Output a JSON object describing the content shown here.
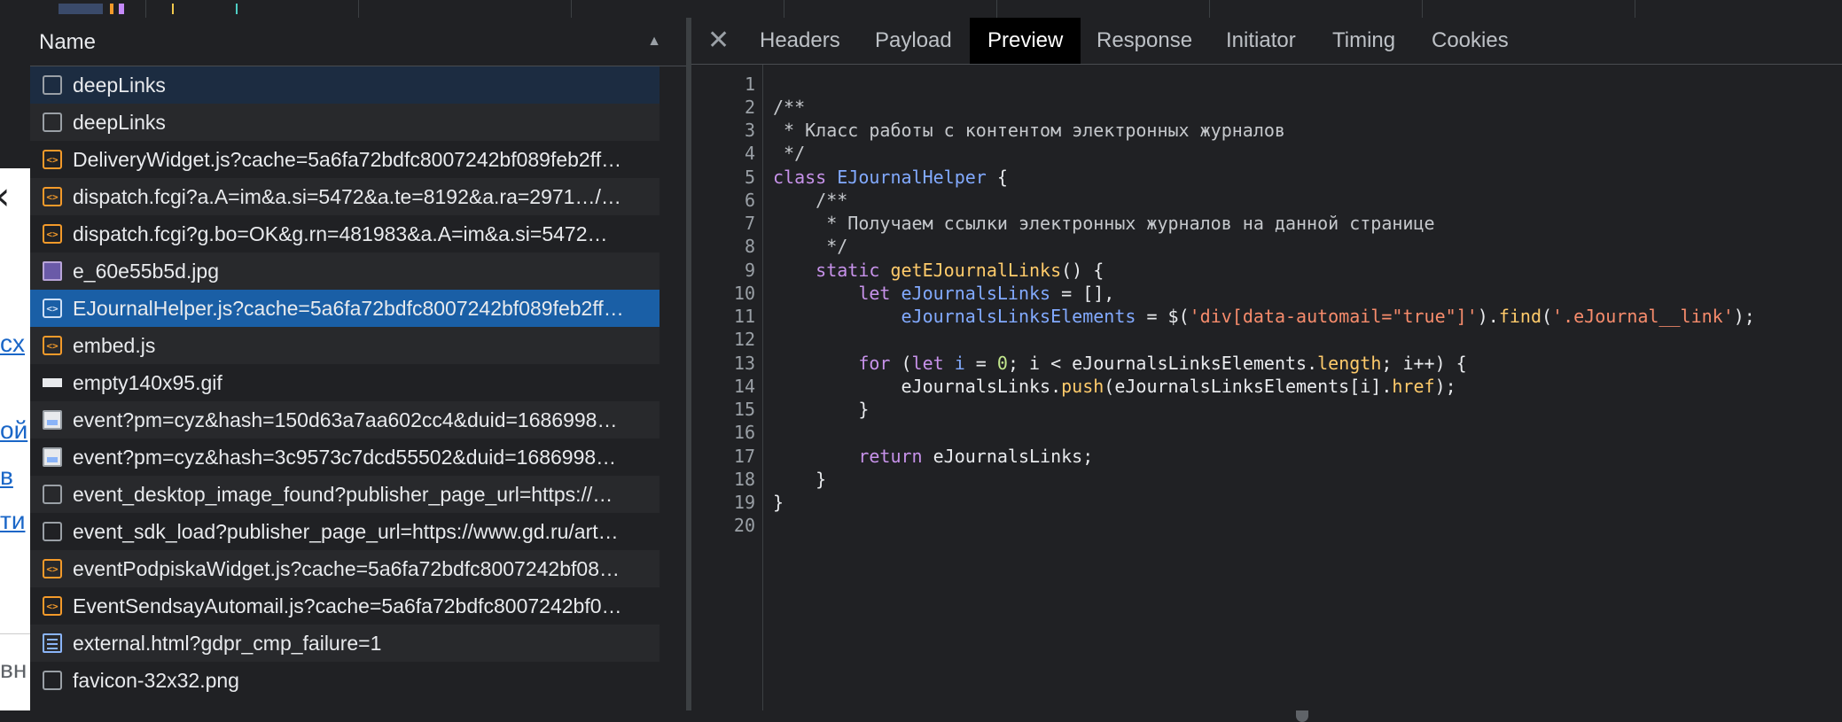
{
  "background_page": {
    "fragments": [
      "сх",
      "ой",
      "в",
      "ти",
      "вн"
    ]
  },
  "network_list": {
    "column_header": "Name",
    "sort_indicator": "▲",
    "rows": [
      {
        "icon": "checkbox-icon",
        "name": "deepLinks"
      },
      {
        "icon": "checkbox-icon",
        "name": "deepLinks"
      },
      {
        "icon": "script-icon",
        "name": "DeliveryWidget.js?cache=5a6fa72bdfc8007242bf089feb2ff…"
      },
      {
        "icon": "script-icon",
        "name": "dispatch.fcgi?a.A=im&a.si=5472&a.te=8192&a.ra=2971…/…"
      },
      {
        "icon": "script-icon",
        "name": "dispatch.fcgi?g.bo=OK&g.rn=481983&a.A=im&a.si=5472…"
      },
      {
        "icon": "image-icon",
        "name": "e_60e55b5d.jpg"
      },
      {
        "icon": "script-icon",
        "name": "EJournalHelper.js?cache=5a6fa72bdfc8007242bf089feb2ff…"
      },
      {
        "icon": "script-icon",
        "name": "embed.js"
      },
      {
        "icon": "gif-icon",
        "name": "empty140x95.gif"
      },
      {
        "icon": "event-icon",
        "name": "event?pm=cyz&hash=150d63a7aa602cc4&duid=1686998…"
      },
      {
        "icon": "event-icon",
        "name": "event?pm=cyz&hash=3c9573c7dcd55502&duid=1686998…"
      },
      {
        "icon": "checkbox-icon",
        "name": "event_desktop_image_found?publisher_page_url=https://…"
      },
      {
        "icon": "checkbox-icon",
        "name": "event_sdk_load?publisher_page_url=https://www.gd.ru/art…"
      },
      {
        "icon": "script-icon",
        "name": "eventPodpiskaWidget.js?cache=5a6fa72bdfc8007242bf08…"
      },
      {
        "icon": "script-icon",
        "name": "EventSendsayAutomail.js?cache=5a6fa72bdfc8007242bf0…"
      },
      {
        "icon": "html-doc-icon",
        "name": "external.html?gdpr_cmp_failure=1"
      },
      {
        "icon": "checkbox-icon",
        "name": "favicon-32x32.png"
      }
    ],
    "selected_index": 6,
    "highlighted_index": 0
  },
  "detail": {
    "close_label": "✕",
    "tabs": [
      "Headers",
      "Payload",
      "Preview",
      "Response",
      "Initiator",
      "Timing",
      "Cookies"
    ],
    "active_tab": "Preview",
    "line_numbers": [
      "1",
      "2",
      "3",
      "4",
      "5",
      "6",
      "7",
      "8",
      "9",
      "10",
      "11",
      "12",
      "13",
      "14",
      "15",
      "16",
      "17",
      "18",
      "19",
      "20"
    ]
  },
  "colors": {
    "selected_row": "#1a5fa6",
    "script_icon": "#f39a2a",
    "keyword": "#c792ea",
    "string": "#f78c6c",
    "function": "#ffcb6b"
  }
}
